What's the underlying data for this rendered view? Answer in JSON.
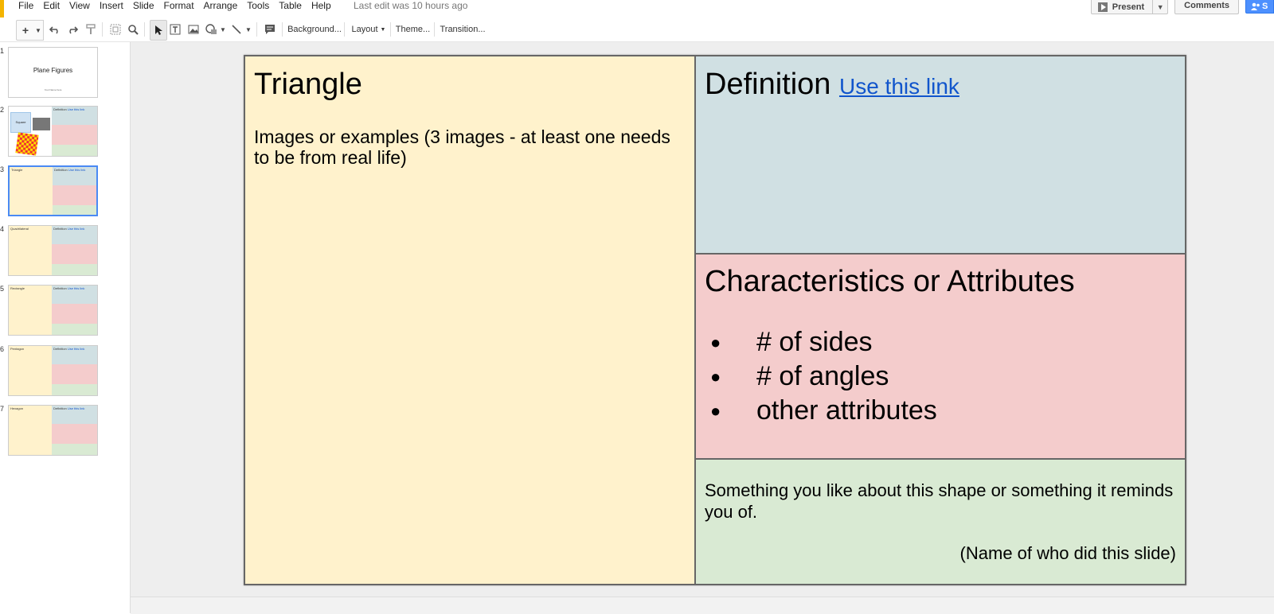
{
  "menubar": {
    "items": [
      "File",
      "Edit",
      "View",
      "Insert",
      "Slide",
      "Format",
      "Arrange",
      "Tools",
      "Table",
      "Help"
    ],
    "last_edit": "Last edit was 10 hours ago",
    "present_label": "Present",
    "comments_label": "Comments",
    "share_label": "S"
  },
  "toolbar": {
    "background": "Background...",
    "layout": "Layout",
    "theme": "Theme...",
    "transition": "Transition..."
  },
  "filmstrip": {
    "slides": [
      {
        "num": "1",
        "title": "Plane Figures",
        "subtitle": "Your Name here"
      },
      {
        "num": "2",
        "title": "Square",
        "def": "Definition",
        "link": "Use this link"
      },
      {
        "num": "3",
        "title": "Triangle",
        "def": "Definition",
        "link": "Use this link"
      },
      {
        "num": "4",
        "title": "Quadrilateral",
        "def": "Definition",
        "link": "Use this link"
      },
      {
        "num": "5",
        "title": "Rectangle",
        "def": "Definition",
        "link": "Use this link"
      },
      {
        "num": "6",
        "title": "Pentagon",
        "def": "Definition",
        "link": "Use this link"
      },
      {
        "num": "7",
        "title": "Hexagon",
        "def": "Definition",
        "link": "Use this link"
      }
    ]
  },
  "slide": {
    "title": "Triangle",
    "images_text": "Images or examples (3 images - at least one needs to be from real life)",
    "definition_title": "Definition",
    "definition_link": "Use this link",
    "characteristics_title": "Characteristics or Attributes",
    "bullets": [
      "# of sides",
      "# of angles",
      "other attributes"
    ],
    "something_text": "Something you like about this shape or something it reminds you of.",
    "name_text": "(Name of who did this slide)"
  },
  "colors": {
    "yellow": "#fff2cc",
    "blue": "#d0e0e3",
    "pink": "#f4cccc",
    "green": "#d9ead3",
    "link": "#1155cc"
  }
}
